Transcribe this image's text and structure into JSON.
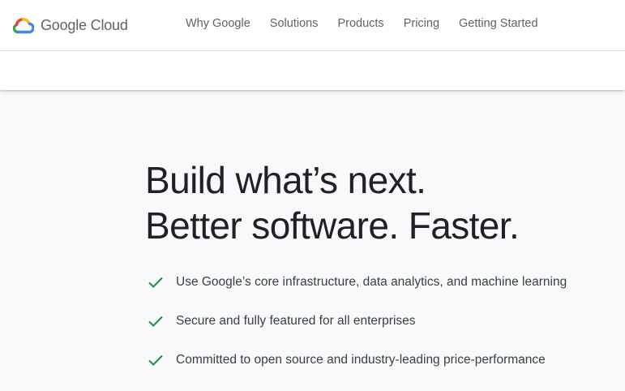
{
  "brand": {
    "name": "Google Cloud",
    "logo_icon": "google-cloud-logo-icon",
    "colors": {
      "blue": "#4285f4",
      "red": "#ea4335",
      "yellow": "#fbbc04",
      "green": "#34a853"
    }
  },
  "nav": {
    "items": [
      {
        "label": "Why Google"
      },
      {
        "label": "Solutions"
      },
      {
        "label": "Products"
      },
      {
        "label": "Pricing"
      },
      {
        "label": "Getting Started"
      }
    ]
  },
  "hero": {
    "title_line1": "Build what’s next.",
    "title_line2": "Better software. Faster.",
    "features": [
      {
        "icon": "checkmark-icon",
        "text": "Use Google’s core infrastructure, data analytics, and machine learning"
      },
      {
        "icon": "checkmark-icon",
        "text": "Secure and fully featured for all enterprises"
      },
      {
        "icon": "checkmark-icon",
        "text": "Committed to open source and industry-leading price-performance"
      }
    ],
    "check_color": "#1e8e3e"
  }
}
